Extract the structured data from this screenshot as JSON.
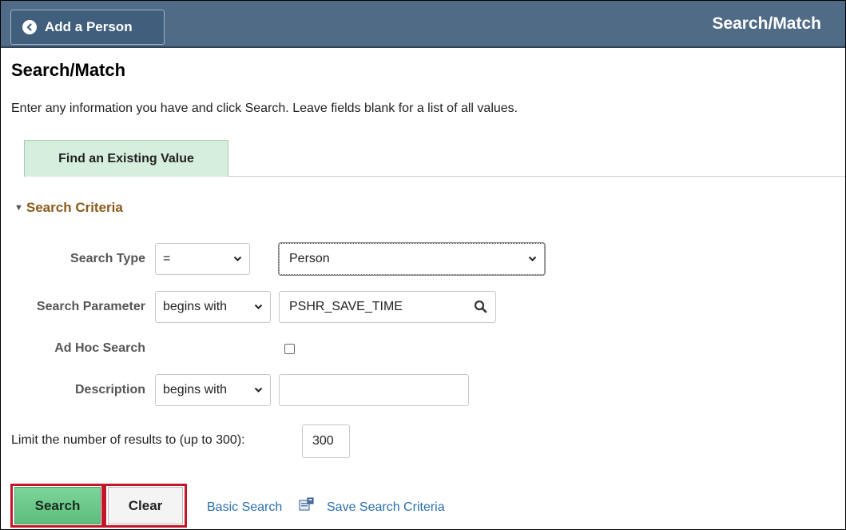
{
  "header": {
    "back_label": "Add a Person",
    "page_heading": "Search/Match"
  },
  "page": {
    "title": "Search/Match",
    "instructions": "Enter any information you have and click Search. Leave fields blank for a list of all values."
  },
  "tabs": [
    {
      "label": "Find an Existing Value"
    }
  ],
  "criteria": {
    "section_label": "Search Criteria",
    "search_type": {
      "label": "Search Type",
      "operator": "=",
      "value": "Person"
    },
    "search_parameter": {
      "label": "Search Parameter",
      "operator": "begins with",
      "value": "PSHR_SAVE_TIME"
    },
    "ad_hoc": {
      "label": "Ad Hoc Search",
      "checked": false
    },
    "description": {
      "label": "Description",
      "operator": "begins with",
      "value": ""
    }
  },
  "limit": {
    "label": "Limit the number of results to (up to 300):",
    "value": "300"
  },
  "actions": {
    "search_label": "Search",
    "clear_label": "Clear",
    "basic_search_label": "Basic Search",
    "save_criteria_label": "Save Search Criteria"
  },
  "colors": {
    "header_bg": "#4f6b86",
    "tab_bg": "#d6eedd",
    "section_label": "#8a5a1a",
    "search_button": "#6cc98a",
    "highlight_border": "#c3162a",
    "link": "#2a6fb0"
  }
}
